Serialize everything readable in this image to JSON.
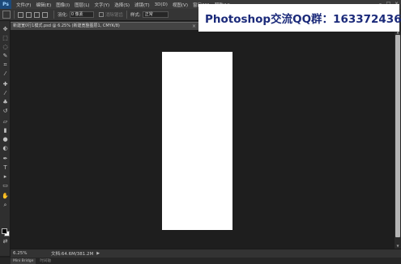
{
  "app": {
    "logo": "Ps",
    "menu": [
      "文件(F)",
      "编辑(E)",
      "图像(I)",
      "图层(L)",
      "文字(Y)",
      "选择(S)",
      "滤镜(T)",
      "3D(D)",
      "视图(V)",
      "窗口(W)",
      "帮助(H)"
    ],
    "window_controls": [
      "–",
      "□",
      "×"
    ]
  },
  "options_bar": {
    "feather_label": "羽化:",
    "feather_value": "0 像素",
    "antialias_label": "消除锯齿",
    "style_label": "样式:",
    "style_value": "正常"
  },
  "watermark": {
    "text": "Photoshop交流QQ群：163372436"
  },
  "document_tab": {
    "title": "新建宽0行1模式.psd @ 6.25% (新建宽整图层1, CMYK/8)",
    "close_glyph": "×"
  },
  "tools": [
    {
      "icon": "move-icon",
      "glyph": "✥"
    },
    {
      "icon": "marquee-icon",
      "glyph": "⬚"
    },
    {
      "icon": "lasso-icon",
      "glyph": "◌"
    },
    {
      "icon": "quick-select-icon",
      "glyph": "✎"
    },
    {
      "icon": "crop-icon",
      "glyph": "⌗"
    },
    {
      "icon": "eyedropper-icon",
      "glyph": "⁄"
    },
    {
      "icon": "healing-icon",
      "glyph": "✚"
    },
    {
      "icon": "brush-icon",
      "glyph": "⁄"
    },
    {
      "icon": "clone-stamp-icon",
      "glyph": "♣"
    },
    {
      "icon": "history-brush-icon",
      "glyph": "↺"
    },
    {
      "icon": "eraser-icon",
      "glyph": "▱"
    },
    {
      "icon": "gradient-icon",
      "glyph": "▮"
    },
    {
      "icon": "blur-icon",
      "glyph": "●"
    },
    {
      "icon": "dodge-icon",
      "glyph": "◐"
    },
    {
      "icon": "pen-icon",
      "glyph": "✒"
    },
    {
      "icon": "type-icon",
      "glyph": "T"
    },
    {
      "icon": "path-select-icon",
      "glyph": "▸"
    },
    {
      "icon": "shape-icon",
      "glyph": "▭"
    },
    {
      "icon": "hand-icon",
      "glyph": "✋"
    },
    {
      "icon": "zoom-icon",
      "glyph": "⌕"
    },
    {
      "icon": "swap-colors-icon",
      "glyph": "⇄"
    }
  ],
  "status_bar": {
    "zoom": "6.25%",
    "doc_info": "文档:64.6M/381.2M",
    "arrow": "▶"
  },
  "bottom_panel": {
    "tab1": "Mini Bridge",
    "tab2": "时间轴"
  },
  "colors": {
    "foreground": "#000000",
    "background": "#ffffff",
    "artboard": "#ffffff",
    "workspace": "#1e1e1e",
    "watermark_text": "#1b2a7a"
  }
}
